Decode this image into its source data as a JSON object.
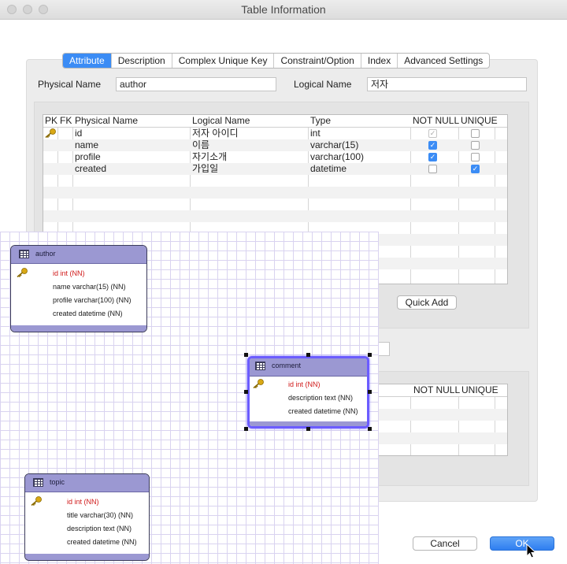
{
  "window": {
    "title": "Table Information"
  },
  "tabs": [
    "Attribute",
    "Description",
    "Complex Unique Key",
    "Constraint/Option",
    "Index",
    "Advanced Settings"
  ],
  "form": {
    "physical_label": "Physical Name",
    "physical_value": "author",
    "logical_label": "Logical Name",
    "logical_value": "저자"
  },
  "columns_grid": {
    "headers": [
      "PK",
      "FK",
      "Physical Name",
      "Logical Name",
      "Type",
      "NOT NULL",
      "UNIQUE"
    ],
    "rows": [
      {
        "pk": true,
        "physical": "id",
        "logical": "저자 아이디",
        "type": "int",
        "not_null": "disabled",
        "unique": false
      },
      {
        "pk": false,
        "physical": "name",
        "logical": "이름",
        "type": "varchar(15)",
        "not_null": true,
        "unique": false
      },
      {
        "pk": false,
        "physical": "profile",
        "logical": "자기소개",
        "type": "varchar(100)",
        "not_null": true,
        "unique": false
      },
      {
        "pk": false,
        "physical": "created",
        "logical": "가입일",
        "type": "datetime",
        "not_null": false,
        "unique": true
      }
    ]
  },
  "quick_add_label": "Quick Add",
  "second_grid": {
    "headers": [
      "NOT NULL",
      "UNIQUE"
    ]
  },
  "buttons": {
    "cancel": "Cancel",
    "ok": "OK"
  },
  "er_tables": {
    "author": {
      "name": "author",
      "columns": [
        "id int (NN)",
        "name varchar(15) (NN)",
        "profile varchar(100) (NN)",
        "created datetime (NN)"
      ]
    },
    "comment": {
      "name": "comment",
      "columns": [
        "id int (NN)",
        "description text (NN)",
        "created datetime (NN)"
      ]
    },
    "topic": {
      "name": "topic",
      "columns": [
        "id int (NN)",
        "title varchar(30) (NN)",
        "description text (NN)",
        "created datetime (NN)"
      ]
    }
  },
  "colors": {
    "accent": "#3b8cf5",
    "er_header": "#9b98d2",
    "selection": "#6b5cff",
    "pk_text": "#d01818"
  }
}
